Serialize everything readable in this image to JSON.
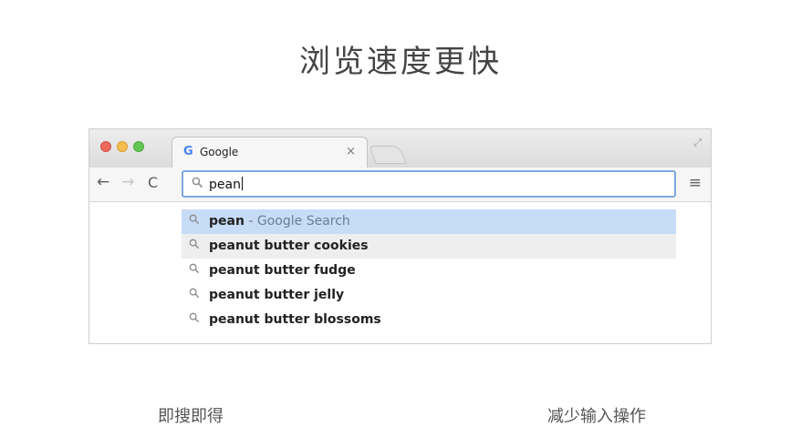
{
  "headline": "浏览速度更快",
  "browser": {
    "tab": {
      "favicon": "G",
      "title": "Google",
      "close_label": "×"
    },
    "nav": {
      "back": "←",
      "forward": "→",
      "reload": "C",
      "menu": "≡"
    },
    "omnibox": {
      "search_icon": "search-icon",
      "value": "pean"
    },
    "suggestions": [
      {
        "icon": "search-icon",
        "bold": "pean",
        "separator": " - ",
        "provider": "Google Search"
      },
      {
        "icon": "search-icon",
        "prefix": "peanut ",
        "bold": "butter cookies"
      },
      {
        "icon": "search-icon",
        "prefix": "peanut ",
        "bold": "butter fudge"
      },
      {
        "icon": "search-icon",
        "prefix": "peanut ",
        "bold": "butter jelly"
      },
      {
        "icon": "search-icon",
        "prefix": "peanut ",
        "bold": "butter blossoms"
      }
    ]
  },
  "captions": {
    "left": "即搜即得",
    "right": "减少输入操作"
  }
}
